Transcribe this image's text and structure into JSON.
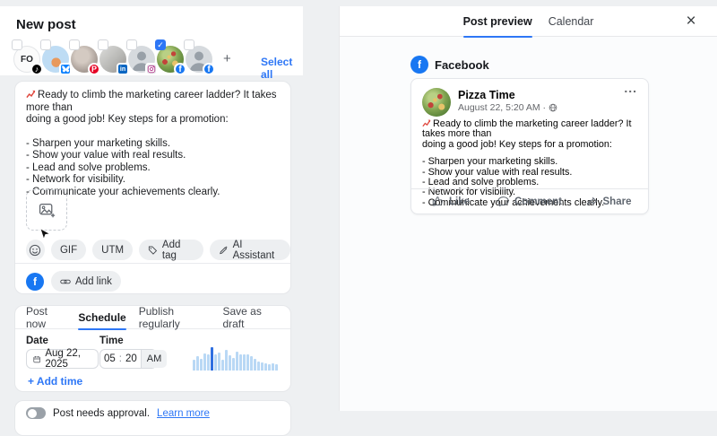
{
  "colors": {
    "accent": "#2e77f6",
    "facebook": "#1877f2",
    "pinterest": "#e60023",
    "linkedin": "#0a66c2",
    "tiktok": "#000000",
    "bluesky": "#1083fe",
    "bar_light": "#b9d8f5",
    "bar_selected": "#2f6fe0"
  },
  "composer": {
    "title": "New post",
    "select_all_label": "Select all",
    "add_account_glyph": "+",
    "accounts": [
      {
        "platform": "TikTok",
        "initials": "FO",
        "selected": false
      },
      {
        "platform": "Bluesky",
        "selected": false
      },
      {
        "platform": "Pinterest",
        "selected": false
      },
      {
        "platform": "LinkedIn",
        "selected": false
      },
      {
        "platform": "Instagram",
        "selected": false
      },
      {
        "platform": "Facebook",
        "selected": true
      },
      {
        "platform": "Facebook",
        "selected": false
      }
    ],
    "post_text": {
      "emoji": "chart-increasing-emoji",
      "intro": "Ready to climb the marketing career ladder? It takes more than\ndoing a good job! Key steps for a promotion:",
      "bullets": "- Sharpen your marketing skills.\n- Show your value with real results.\n- Lead and solve problems.\n- Network for visibility.\n- Communicate your achievements clearly."
    },
    "toolbar": {
      "gif": "GIF",
      "utm": "UTM",
      "add_tag": "Add tag",
      "ai_assistant": "AI Assistant"
    },
    "add_link_label": "Add link",
    "publish_tabs": [
      {
        "label": "Post now",
        "active": false
      },
      {
        "label": "Schedule",
        "active": true
      },
      {
        "label": "Publish regularly",
        "active": false
      },
      {
        "label": "Save as draft",
        "active": false
      }
    ],
    "schedule": {
      "date_label": "Date",
      "date_value": "Aug 22, 2025",
      "time_label": "Time",
      "time_hour": "05",
      "time_colon": ":",
      "time_minute": "20",
      "time_meridiem": "AM",
      "add_time_label": "+ Add time",
      "best_times_histogram": {
        "type": "bar",
        "values": [
          45,
          62,
          50,
          72,
          68,
          100,
          70,
          75,
          45,
          90,
          65,
          55,
          80,
          70,
          70,
          68,
          62,
          50,
          40,
          35,
          30,
          25,
          30,
          25
        ],
        "selected_index": 5
      }
    },
    "approval": {
      "label": "Post needs approval.",
      "link": "Learn more"
    }
  },
  "preview": {
    "tabs": [
      {
        "label": "Post preview",
        "active": true
      },
      {
        "label": "Calendar",
        "active": false
      }
    ],
    "close_glyph": "×",
    "network_label": "Facebook",
    "card": {
      "page_name": "Pizza Time",
      "timestamp": "August 22, 5:20 AM ·",
      "menu_glyph": "...",
      "text_intro": "Ready to climb the marketing career ladder? It takes more than\ndoing a good job! Key steps for a promotion:",
      "text_bullets": "- Sharpen your marketing skills.\n- Show your value with real results.\n- Lead and solve problems.\n- Network for visibility.\n- Communicate your achievements clearly.",
      "actions": [
        {
          "label": "Like"
        },
        {
          "label": "Comment"
        },
        {
          "label": "Share"
        }
      ]
    }
  },
  "icons": {
    "tiktok_glyph": "♪",
    "pinterest_glyph": "P",
    "linkedin_glyph": "in",
    "facebook_glyph": "f",
    "check_glyph": "✓"
  }
}
